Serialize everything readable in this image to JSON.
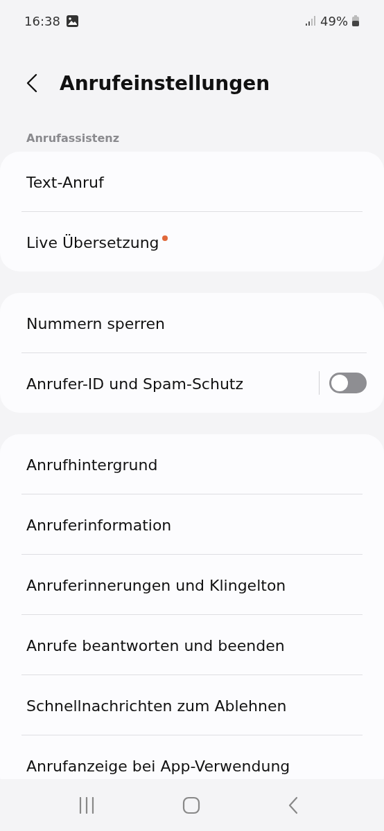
{
  "status_bar": {
    "time": "16:38",
    "battery": "49%"
  },
  "header": {
    "title": "Anrufeinstellungen"
  },
  "sections": [
    {
      "label": "Anrufassistenz",
      "items": [
        {
          "kind": "link",
          "title": "Text-Anruf",
          "new_badge": false
        },
        {
          "kind": "link",
          "title": "Live Übersetzung",
          "new_badge": true
        }
      ]
    },
    {
      "items": [
        {
          "kind": "link",
          "title": "Nummern sperren",
          "new_badge": false
        },
        {
          "kind": "switch",
          "title": "Anrufer-ID und Spam-Schutz",
          "new_badge": false,
          "on": false
        }
      ]
    },
    {
      "items": [
        {
          "kind": "link",
          "title": "Anrufhintergrund",
          "new_badge": false
        },
        {
          "kind": "link",
          "title": "Anruferinformation",
          "new_badge": false
        },
        {
          "kind": "link",
          "title": "Anruferinnerungen und Klingelton",
          "new_badge": false
        },
        {
          "kind": "link",
          "title": "Anrufe beantworten und beenden",
          "new_badge": false
        },
        {
          "kind": "link",
          "title": "Schnellnachrichten zum Ablehnen",
          "new_badge": false
        },
        {
          "kind": "link",
          "title": "Anrufanzeige bei App-Verwendung",
          "new_badge": false
        }
      ]
    }
  ]
}
